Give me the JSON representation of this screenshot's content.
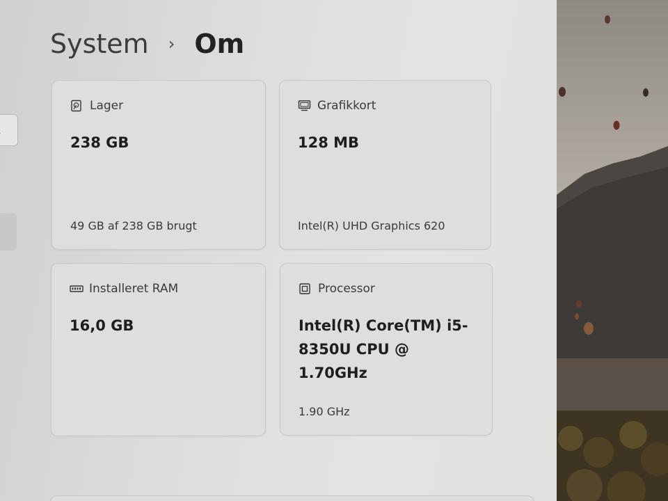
{
  "breadcrumb": {
    "parent": "System",
    "separator": "›",
    "current": "Om"
  },
  "nav": {
    "search_icon": "search-icon"
  },
  "cards": {
    "storage": {
      "icon": "storage-icon",
      "title": "Lager",
      "value": "238 GB",
      "detail": "49 GB af 238 GB brugt"
    },
    "gpu": {
      "icon": "monitor-icon",
      "title": "Grafikkort",
      "value": "128 MB",
      "detail": "Intel(R) UHD Graphics 620"
    },
    "ram": {
      "icon": "ram-icon",
      "title": "Installeret RAM",
      "value": "16,0 GB"
    },
    "cpu": {
      "icon": "cpu-icon",
      "title": "Processor",
      "value": "Intel(R) Core(TM) i5-8350U CPU @ 1.70GHz",
      "detail": "1.90 GHz"
    }
  },
  "colors": {
    "card_bg": "#dededc",
    "card_border": "#c7c7c5",
    "text_primary": "#1e1e1e"
  }
}
